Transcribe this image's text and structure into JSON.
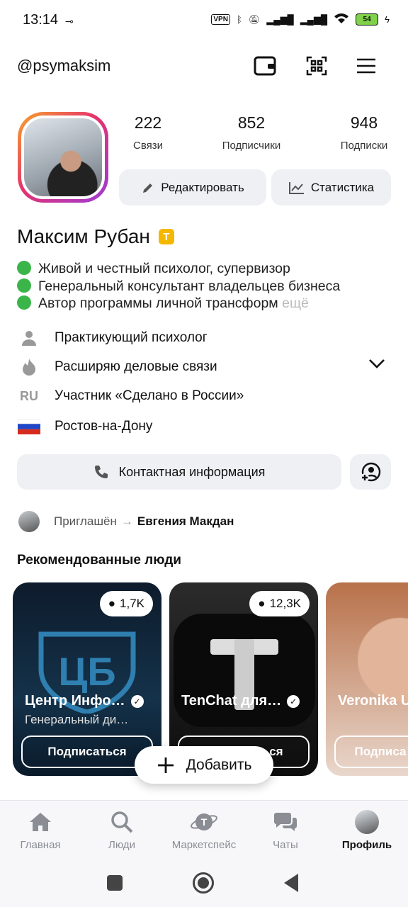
{
  "status_bar": {
    "time": "13:14",
    "vpn": "VPN",
    "battery": "54"
  },
  "header": {
    "handle": "@psymaksim"
  },
  "profile": {
    "stats": [
      {
        "value": "222",
        "label": "Связи"
      },
      {
        "value": "852",
        "label": "Подписчики"
      },
      {
        "value": "948",
        "label": "Подписки"
      }
    ],
    "edit_label": "Редактировать",
    "stats_label": "Статистика",
    "name": "Максим Рубан",
    "badge": "T",
    "bio": [
      "Живой и честный психолог, супервизор",
      "Генеральный консультант владельцев бизнеса",
      "Автор программы личной трансформ"
    ],
    "bio_more": "ещё",
    "info": [
      {
        "icon": "person-icon",
        "text": "Практикующий психолог"
      },
      {
        "icon": "flame-icon",
        "text": "Расширяю деловые связи"
      },
      {
        "icon": "RU",
        "text": "Участник «Сделано в России»"
      },
      {
        "icon": "russia-flag-icon",
        "text": "Ростов-на-Дону"
      }
    ],
    "contact_label": "Контактная информация",
    "invited_label": "Приглашён",
    "invited_by": "Евгения Макдан"
  },
  "recommended": {
    "title": "Рекомендованные люди",
    "cards": [
      {
        "count": "1,7K",
        "name": "Центр Инфо…",
        "subtitle": "Генеральный ди…",
        "button": "Подписаться"
      },
      {
        "count": "12,3K",
        "name": "TenChat для…",
        "subtitle": "",
        "button": "Подписаться"
      },
      {
        "count": "",
        "name": "Veronika U",
        "subtitle": "",
        "button": "Подписа"
      }
    ]
  },
  "fab_label": "Добавить",
  "bottom_nav": [
    {
      "label": "Главная"
    },
    {
      "label": "Люди"
    },
    {
      "label": "Маркетспейс"
    },
    {
      "label": "Чаты"
    },
    {
      "label": "Профиль"
    }
  ],
  "colors": {
    "accent_green": "#3bb54a",
    "badge_yellow": "#f5b800",
    "chip_bg": "#eef0f4"
  }
}
